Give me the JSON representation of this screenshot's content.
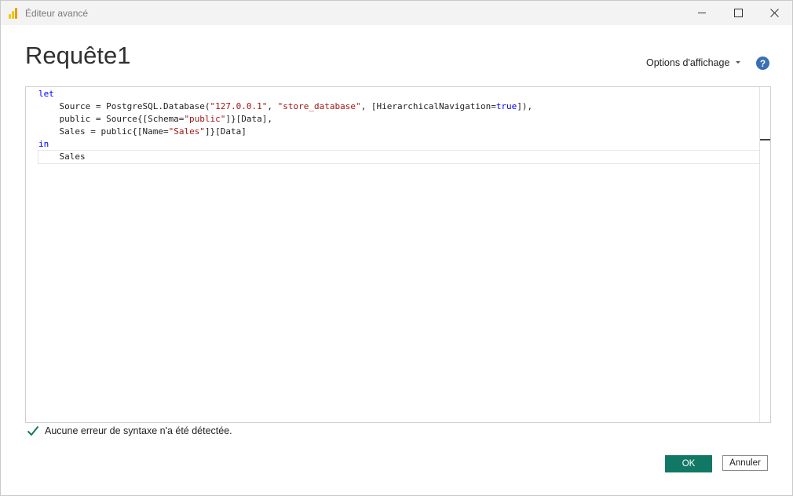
{
  "window": {
    "title": "Éditeur avancé"
  },
  "header": {
    "query_name": "Requête1",
    "view_options_label": "Options d'affichage",
    "help_glyph": "?"
  },
  "editor": {
    "lines": [
      [
        {
          "t": "let",
          "c": "kw"
        }
      ],
      [
        {
          "t": "    Source = PostgreSQL.Database(",
          "c": ""
        },
        {
          "t": "\"127.0.0.1\"",
          "c": "str"
        },
        {
          "t": ", ",
          "c": ""
        },
        {
          "t": "\"store_database\"",
          "c": "str"
        },
        {
          "t": ", [HierarchicalNavigation=",
          "c": ""
        },
        {
          "t": "true",
          "c": "kw"
        },
        {
          "t": "]),",
          "c": ""
        }
      ],
      [
        {
          "t": "    public = Source{[Schema=",
          "c": ""
        },
        {
          "t": "\"public\"",
          "c": "str"
        },
        {
          "t": "]}[Data],",
          "c": ""
        }
      ],
      [
        {
          "t": "    Sales = public{[Name=",
          "c": ""
        },
        {
          "t": "\"Sales\"",
          "c": "str"
        },
        {
          "t": "]}[Data]",
          "c": ""
        }
      ],
      [
        {
          "t": "in",
          "c": "kw"
        }
      ],
      [
        {
          "t": "    Sales",
          "c": ""
        }
      ]
    ],
    "current_line": 5
  },
  "status": {
    "message": "Aucune erreur de syntaxe n'a été détectée."
  },
  "footer": {
    "ok_label": "OK",
    "cancel_label": "Annuler"
  },
  "colors": {
    "ok_button": "#117865",
    "help_icon": "#3a6fb4",
    "keyword": "#0000ff",
    "string": "#a31515",
    "check": "#117865"
  }
}
